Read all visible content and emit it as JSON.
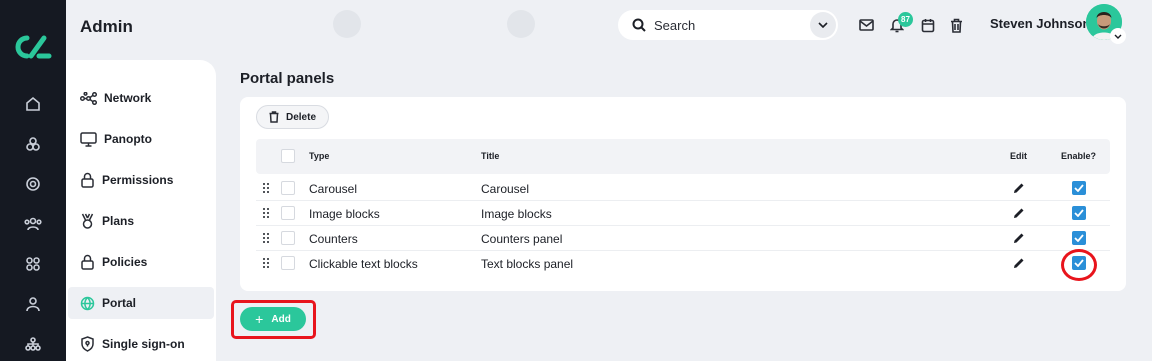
{
  "header": {
    "title": "Admin",
    "search_placeholder": "Search",
    "notification_count": "87",
    "user_name": "Steven Johnson"
  },
  "sidebar": {
    "items": [
      {
        "label": "Network",
        "icon": "network-icon"
      },
      {
        "label": "Panopto",
        "icon": "monitor-icon"
      },
      {
        "label": "Permissions",
        "icon": "lock-icon"
      },
      {
        "label": "Plans",
        "icon": "medal-icon"
      },
      {
        "label": "Policies",
        "icon": "lock-icon"
      },
      {
        "label": "Portal",
        "icon": "globe-icon",
        "active": true
      },
      {
        "label": "Single sign-on",
        "icon": "shield-icon"
      }
    ]
  },
  "main": {
    "title": "Portal panels",
    "delete_label": "Delete",
    "columns": {
      "type": "Type",
      "title": "Title",
      "edit": "Edit",
      "enable": "Enable?"
    },
    "rows": [
      {
        "type": "Carousel",
        "title": "Carousel",
        "enabled": true
      },
      {
        "type": "Image blocks",
        "title": "Image blocks",
        "enabled": true
      },
      {
        "type": "Counters",
        "title": "Counters panel",
        "enabled": true
      },
      {
        "type": "Clickable text blocks",
        "title": "Text blocks panel",
        "enabled": true
      }
    ],
    "add_label": "Add"
  },
  "colors": {
    "accent": "#2bc79b",
    "rail": "#151922",
    "checkbox": "#2a8fd8",
    "highlight": "#e8141c"
  }
}
